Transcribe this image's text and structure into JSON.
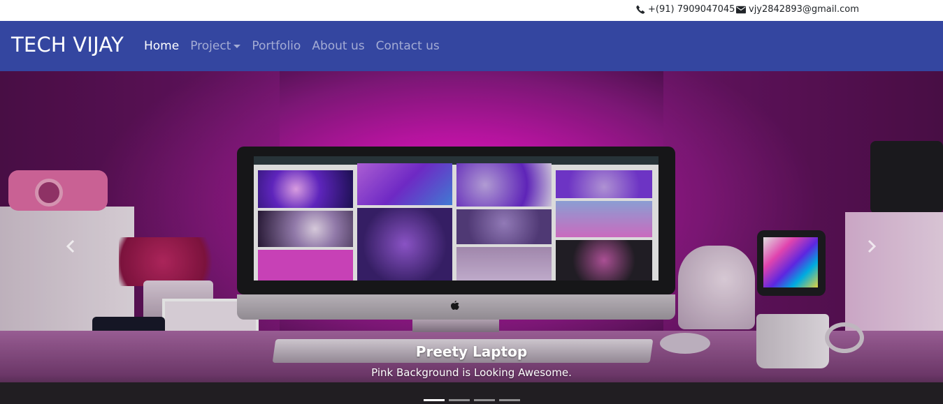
{
  "topbar": {
    "phone": "+(91) 7909047045",
    "email": "vjy2842893@gmail.com",
    "phone_icon": "phone-icon",
    "email_icon": "envelope-icon"
  },
  "navbar": {
    "brand": "TECH VIJAY",
    "items": [
      {
        "label": "Home",
        "active": true
      },
      {
        "label": "Project",
        "dropdown": true
      },
      {
        "label": "Portfolio"
      },
      {
        "label": "About us"
      },
      {
        "label": "Contact us"
      }
    ],
    "background": "#3446a0"
  },
  "carousel": {
    "caption_title": "Preety Laptop",
    "caption_text": "Pink Background is Looking Awesome.",
    "slide_count": 4,
    "active_slide": 1,
    "prev_icon": "chevron-left-icon",
    "next_icon": "chevron-right-icon"
  }
}
